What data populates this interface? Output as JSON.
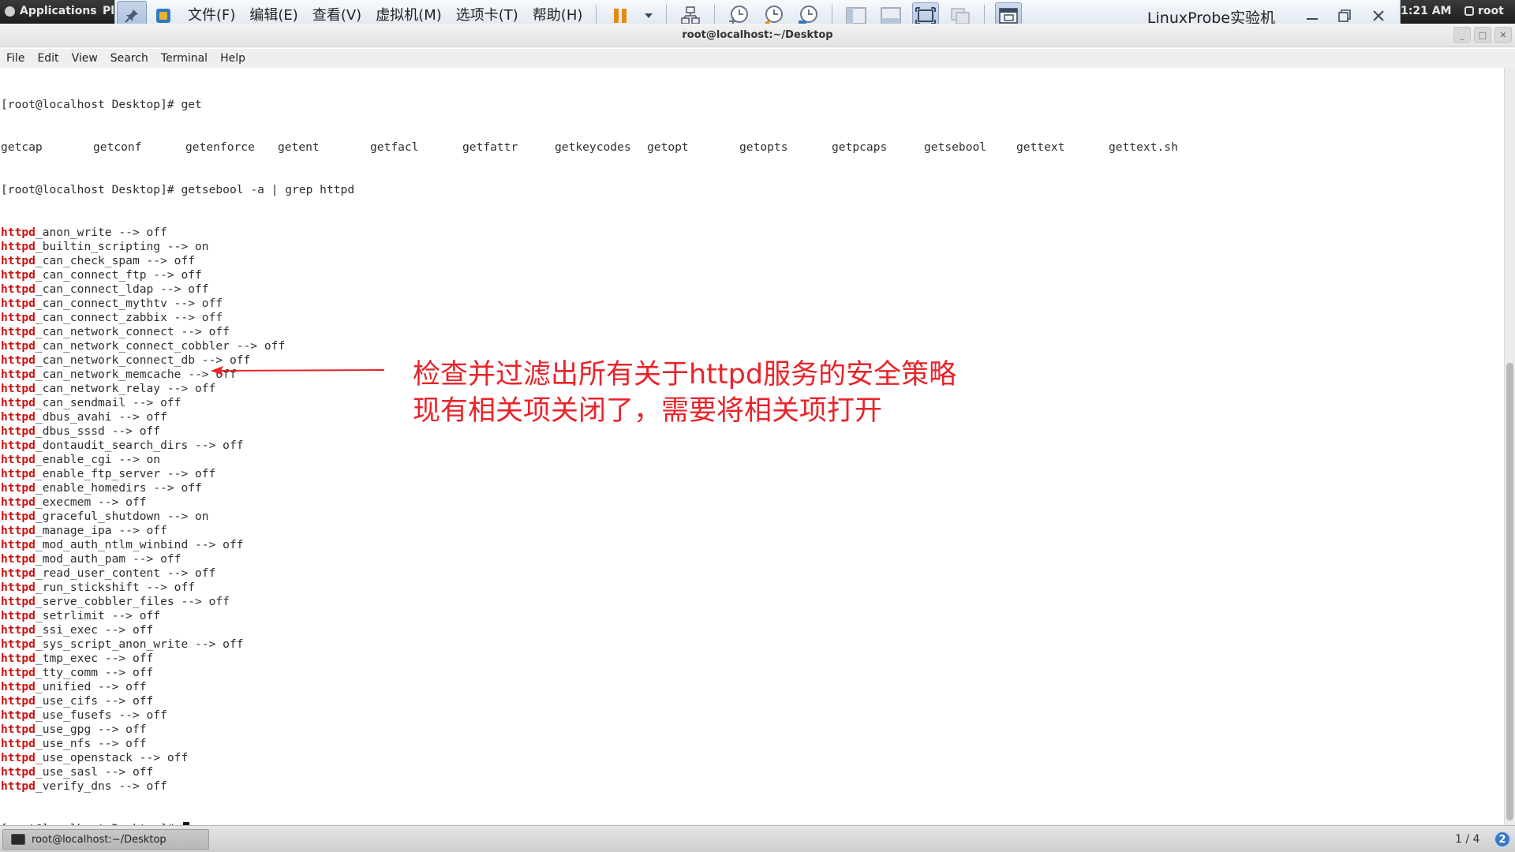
{
  "gnome_topbar": {
    "applications": "Applications",
    "places": "Pl",
    "clock": "1:21 AM",
    "user": "root"
  },
  "vm_toolbar": {
    "menus": [
      "文件(F)",
      "编辑(E)",
      "查看(V)",
      "虚拟机(M)",
      "选项卡(T)",
      "帮助(H)"
    ],
    "title": "LinuxProbe实验机"
  },
  "terminal": {
    "window_title": "root@localhost:~/Desktop",
    "menus": [
      "File",
      "Edit",
      "View",
      "Search",
      "Terminal",
      "Help"
    ],
    "prompt": "[root@localhost Desktop]# ",
    "line1_cmd": "get",
    "completions": [
      "getcap",
      "getconf",
      "getenforce",
      "getent",
      "getfacl",
      "getfattr",
      "getkeycodes",
      "getopt",
      "getopts",
      "getpcaps",
      "getsebool",
      "gettext",
      "gettext.sh"
    ],
    "line2_cmd": "getsebool -a | grep httpd",
    "match_prefix": "httpd",
    "booleans": [
      "_anon_write --> off",
      "_builtin_scripting --> on",
      "_can_check_spam --> off",
      "_can_connect_ftp --> off",
      "_can_connect_ldap --> off",
      "_can_connect_mythtv --> off",
      "_can_connect_zabbix --> off",
      "_can_network_connect --> off",
      "_can_network_connect_cobbler --> off",
      "_can_network_connect_db --> off",
      "_can_network_memcache --> off",
      "_can_network_relay --> off",
      "_can_sendmail --> off",
      "_dbus_avahi --> off",
      "_dbus_sssd --> off",
      "_dontaudit_search_dirs --> off",
      "_enable_cgi --> on",
      "_enable_ftp_server --> off",
      "_enable_homedirs --> off",
      "_execmem --> off",
      "_graceful_shutdown --> on",
      "_manage_ipa --> off",
      "_mod_auth_ntlm_winbind --> off",
      "_mod_auth_pam --> off",
      "_read_user_content --> off",
      "_run_stickshift --> off",
      "_serve_cobbler_files --> off",
      "_setrlimit --> off",
      "_ssi_exec --> off",
      "_sys_script_anon_write --> off",
      "_tmp_exec --> off",
      "_tty_comm --> off",
      "_unified --> off",
      "_use_cifs --> off",
      "_use_fusefs --> off",
      "_use_gpg --> off",
      "_use_nfs --> off",
      "_use_openstack --> off",
      "_use_sasl --> off",
      "_verify_dns --> off"
    ]
  },
  "annotation": {
    "line1": "检查并过滤出所有关于httpd服务的安全策略",
    "line2": "现有相关项关闭了，需要将相关项打开",
    "color": "#e8242a"
  },
  "taskbar": {
    "item": "root@localhost:~/Desktop",
    "workspace": "1 / 4",
    "notify": "2"
  }
}
